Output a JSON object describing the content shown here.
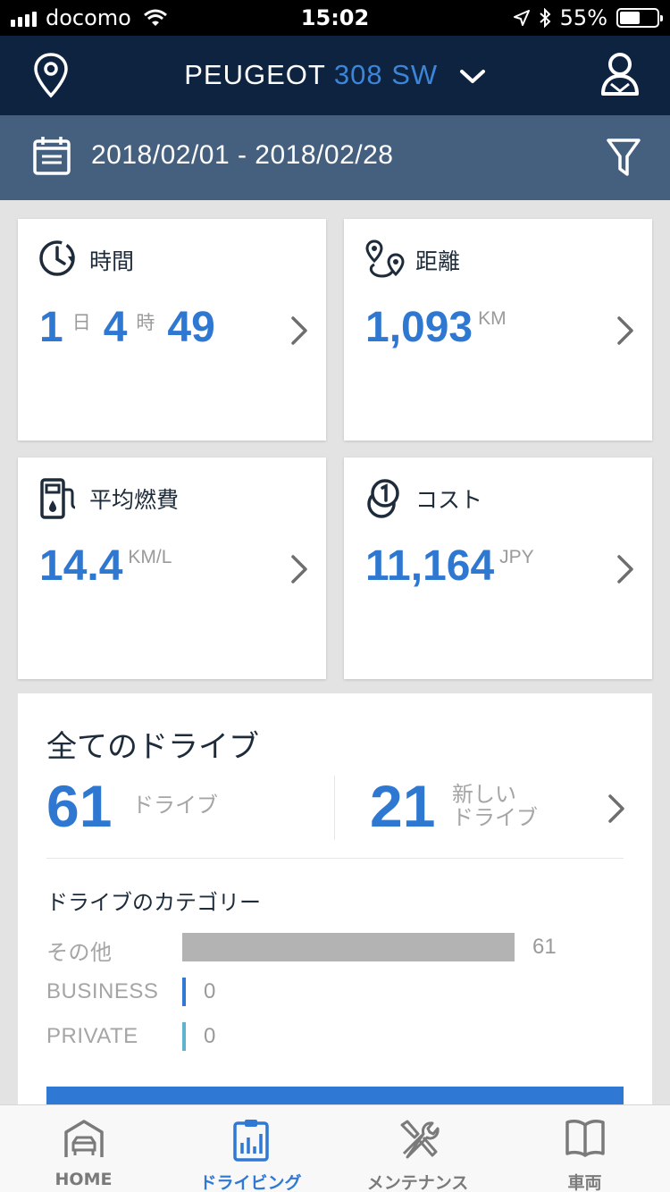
{
  "status_bar": {
    "carrier": "docomo",
    "time": "15:02",
    "battery": "55%",
    "battery_level": 0.55
  },
  "header": {
    "brand": "PEUGEOT",
    "model": "308 SW"
  },
  "date_filter": {
    "range": "2018/02/01 - 2018/02/28"
  },
  "cards": {
    "time": {
      "label": "時間",
      "days": "1",
      "days_unit": "日",
      "hours": "4",
      "hours_unit": "時",
      "minutes": "49"
    },
    "distance": {
      "label": "距離",
      "value": "1,093",
      "unit": "KM"
    },
    "fuel": {
      "label": "平均燃費",
      "value": "14.4",
      "unit": "KM/L"
    },
    "cost": {
      "label": "コスト",
      "value": "11,164",
      "unit": "JPY"
    }
  },
  "drives": {
    "title": "全てのドライブ",
    "total": "61",
    "total_unit": "ドライブ",
    "new": "21",
    "new_unit_line1": "新しい",
    "new_unit_line2": "ドライブ",
    "category_title": "ドライブのカテゴリー",
    "categories": [
      {
        "name": "その他",
        "count": "61",
        "value": 61,
        "color": "#b3b3b3"
      },
      {
        "name": "BUSINESS",
        "count": "0",
        "value": 0,
        "color": "#2f78d4"
      },
      {
        "name": "PRIVATE",
        "count": "0",
        "value": 0,
        "color": "#5fb3cf"
      }
    ]
  },
  "tabs": [
    {
      "label": "HOME",
      "icon": "garage-icon"
    },
    {
      "label": "ドライビング",
      "icon": "clipboard-chart-icon"
    },
    {
      "label": "メンテナンス",
      "icon": "tools-icon"
    },
    {
      "label": "車両",
      "icon": "book-icon"
    }
  ],
  "colors": {
    "header": "#0d2340",
    "datebar": "#44607e",
    "accent": "#2e78d2"
  }
}
